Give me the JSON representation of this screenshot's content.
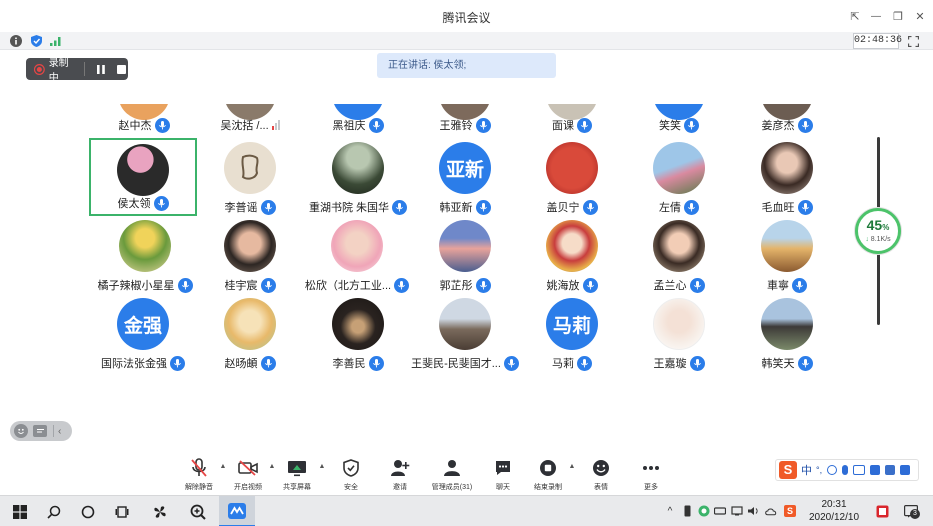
{
  "window": {
    "title": "腾讯会议",
    "controls": {
      "pin": "⇱",
      "minimize": "—",
      "restore": "❐",
      "close": "✕"
    }
  },
  "status": {
    "timer": "02:48:36"
  },
  "recording": {
    "label": "录制中"
  },
  "speaking": {
    "text": "正在讲话: 侯太领;"
  },
  "participants": {
    "row0": [
      {
        "name": "赵中杰"
      },
      {
        "name": "吴沈括 /..."
      },
      {
        "name": "黑祖庆"
      },
      {
        "name": "王雅铃"
      },
      {
        "name": "面课"
      },
      {
        "name": "笑笑"
      },
      {
        "name": "姜彦杰"
      }
    ],
    "row1": [
      {
        "name": "侯太领"
      },
      {
        "name": "李普谣"
      },
      {
        "name": "重湖书院 朱国华"
      },
      {
        "name": "韩亚新",
        "initials": "亚新"
      },
      {
        "name": "盖贝宁"
      },
      {
        "name": "左倩"
      },
      {
        "name": "毛血旺"
      }
    ],
    "row2": [
      {
        "name": "橘子辣椒小星星"
      },
      {
        "name": "桂宇宸"
      },
      {
        "name": "松欣（北方工业..."
      },
      {
        "name": "郭芷彤"
      },
      {
        "name": "姚海放"
      },
      {
        "name": "孟兰心"
      },
      {
        "name": "車寧"
      }
    ],
    "row3": [
      {
        "name": "国际法张金强",
        "initials": "金强"
      },
      {
        "name": "赵旸頔"
      },
      {
        "name": "李善民"
      },
      {
        "name": "王斐民-民斐国才..."
      },
      {
        "name": "马莉",
        "initials": "马莉"
      },
      {
        "name": "王嘉璇"
      },
      {
        "name": "韩笑天"
      }
    ]
  },
  "network": {
    "percent": "45",
    "unit": "%",
    "rate": "8.1K/s"
  },
  "toolbar": {
    "unmute_all": "解除静音",
    "video": "开启视频",
    "share": "共享屏幕",
    "security": "安全",
    "invite": "邀请",
    "members": "管理成员(31)",
    "chat": "聊天",
    "end_record": "结束录制",
    "reactions": "表情",
    "more": "更多"
  },
  "ime": {
    "lang": "中",
    "punct": "°,"
  },
  "taskbar": {
    "time": "20:31",
    "date": "2020/12/10",
    "notifications": "3"
  },
  "colors": {
    "accent": "#2b7de9",
    "active_border": "#3bb36a",
    "gauge": "#4cc36a"
  }
}
